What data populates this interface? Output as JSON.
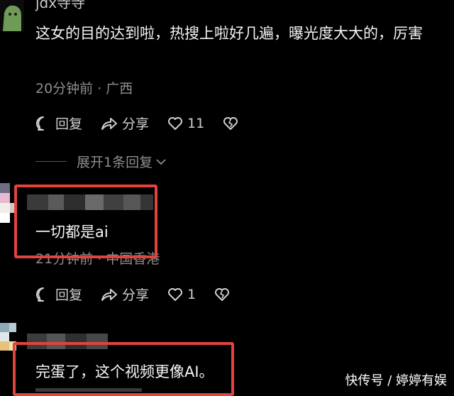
{
  "comment1": {
    "username": "jdx寺寺",
    "text": "这女的目的达到啦，热搜上啦好几遍，曝光度大大的，厉害",
    "meta": "20分钟前 · 广西",
    "reply_label": "回复",
    "share_label": "分享",
    "like_count": "11"
  },
  "expand_replies_label": "展开1条回复",
  "comment2": {
    "text": "一切都是ai",
    "meta": "21分钟前 · 中国香港",
    "reply_label": "回复",
    "share_label": "分享",
    "like_count": "1"
  },
  "comment3": {
    "text": "完蛋了，这个视频更像AI。"
  },
  "watermark": "快传号 / 婷婷有娱",
  "colors": {
    "background": "#000000",
    "highlight_box": "#e0443b"
  }
}
